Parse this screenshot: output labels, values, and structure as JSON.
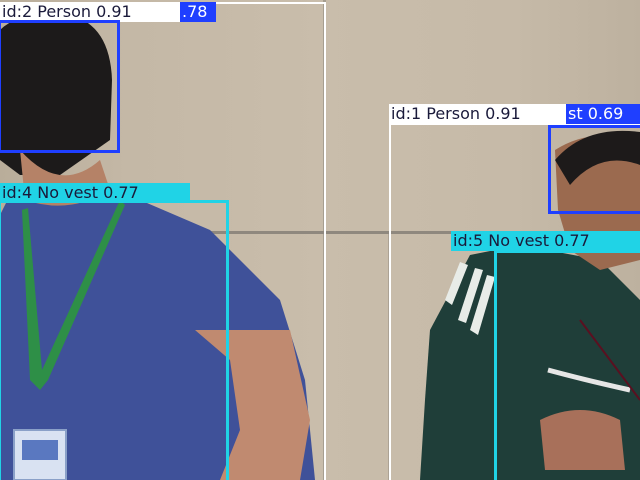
{
  "colors": {
    "person": "#ffffff",
    "head": "#1f3fff",
    "no_vest": "#20d3e6",
    "label_text_dark": "#1a1a3a",
    "label_text_light": "#ffffff"
  },
  "detections": [
    {
      "label": "id:2 Person 0.91",
      "class": "person"
    },
    {
      "label": ".78",
      "class": "head"
    },
    {
      "label": "id:4 No vest 0.77",
      "class": "no_vest"
    },
    {
      "label": "id:1 Person 0.91",
      "class": "person"
    },
    {
      "label": "st 0.69",
      "class": "head"
    },
    {
      "label": "id:5 No vest 0.77",
      "class": "no_vest"
    }
  ]
}
